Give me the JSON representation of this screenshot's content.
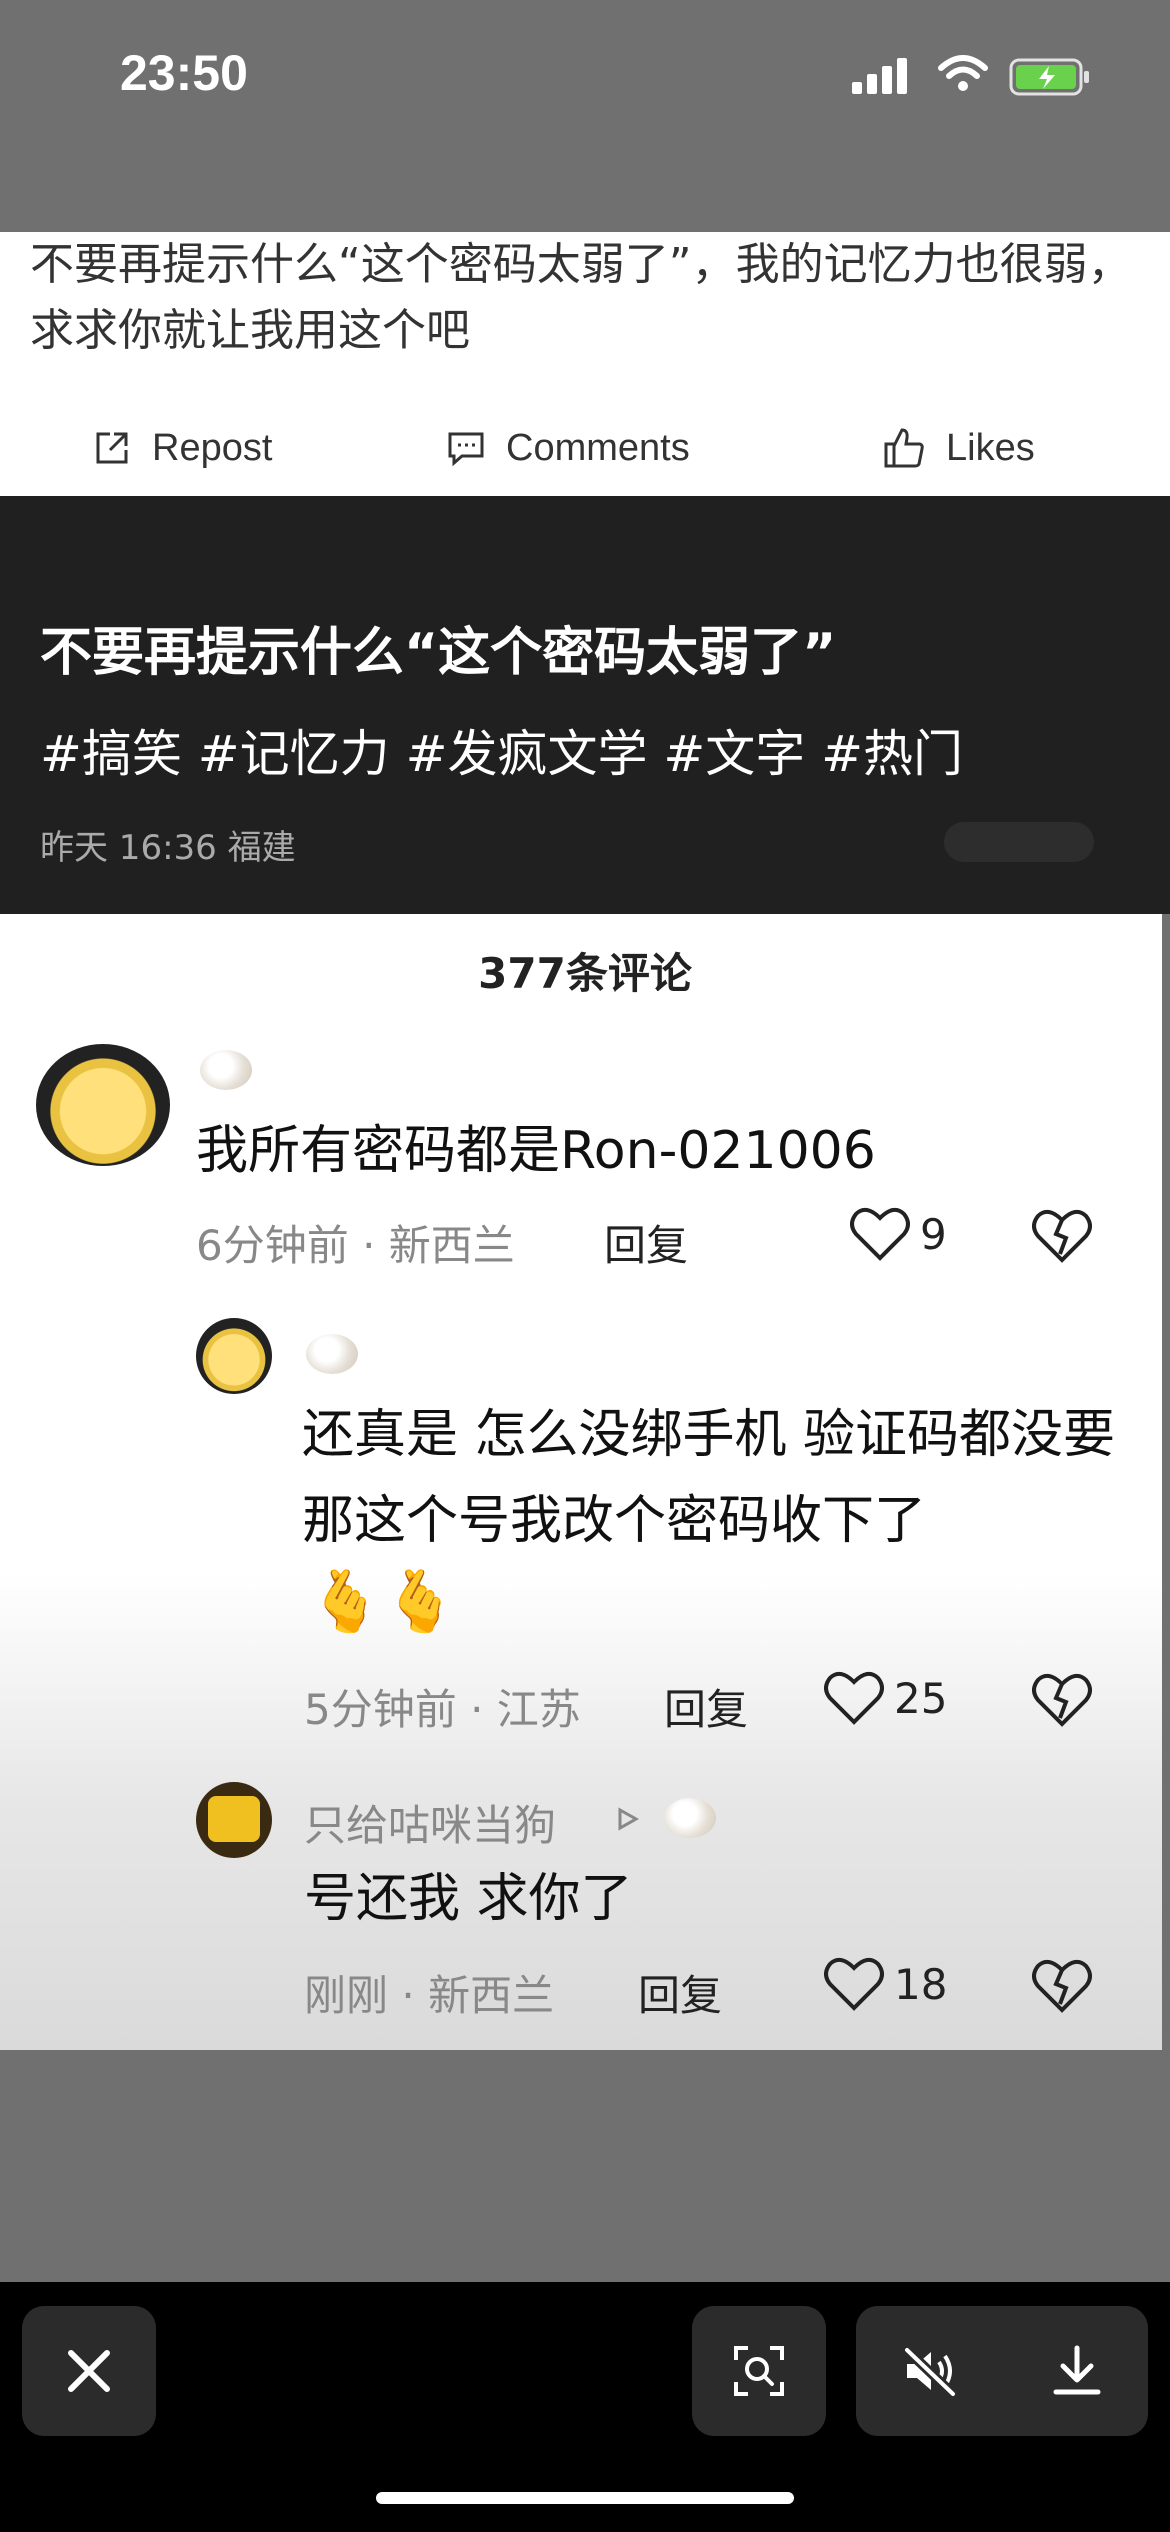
{
  "status_bar": {
    "time": "23:50"
  },
  "post": {
    "text": "不要再提示什么“这个密码太弱了”，我的记忆力也很弱，求求你就让我用这个吧",
    "actions": {
      "repost": "Repost",
      "comments": "Comments",
      "likes": "Likes"
    }
  },
  "video": {
    "title": "不要再提示什么“这个密码太弱了”",
    "tags": "#搞笑 #记忆力 #发疯文学 #文字 #热门",
    "meta": "昨天 16:36 福建"
  },
  "comments": {
    "count": "377条评论",
    "items": [
      {
        "text": "我所有密码都是Ron-021006",
        "time": "6分钟前",
        "location": "新西兰",
        "reply": "回复",
        "likes": "9"
      },
      {
        "text": "还真是 怎么没绑手机 验证码都没要 那这个号我改个密码收下了",
        "emoji": "🫰🫰",
        "time": "5分钟前",
        "location": "江苏",
        "reply": "回复",
        "likes": "25"
      },
      {
        "username": "只给咕咪当狗",
        "text": "号还我 求你了",
        "time": "刚刚",
        "location": "新西兰",
        "reply": "回复",
        "likes": "18"
      }
    ],
    "meta_separator": " · "
  },
  "colors": {
    "dark_bg": "#202020",
    "gray_bg": "#707070",
    "accent_battery": "#6ad14c"
  }
}
